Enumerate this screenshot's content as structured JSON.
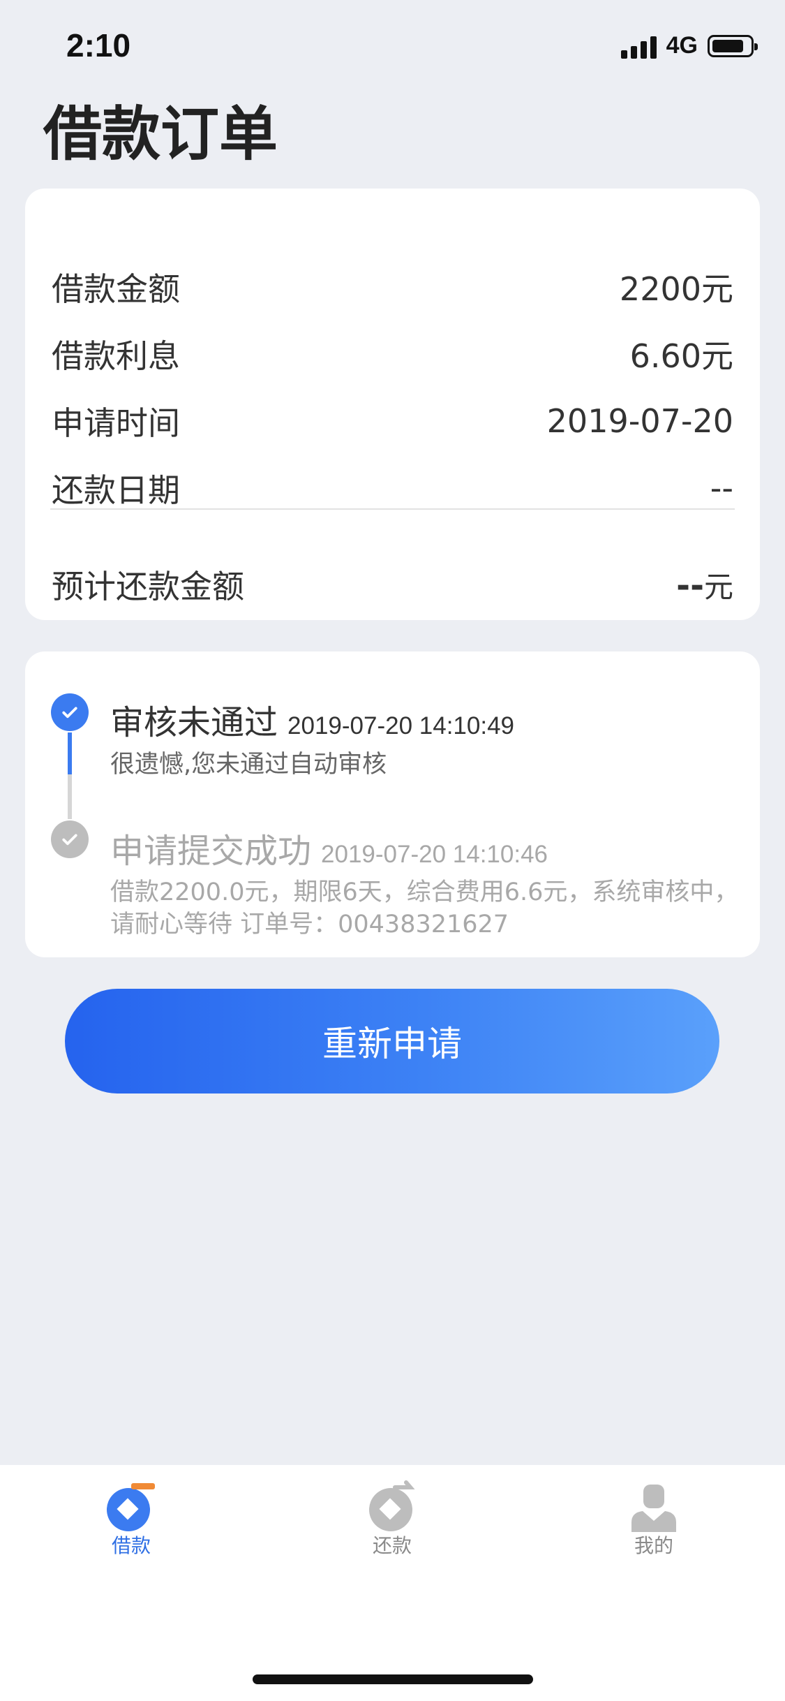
{
  "status_bar": {
    "time": "2:10",
    "network": "4G"
  },
  "page": {
    "title": "借款订单"
  },
  "summary": {
    "rows": [
      {
        "label": "借款金额",
        "value": "2200元"
      },
      {
        "label": "借款利息",
        "value": "6.60元"
      },
      {
        "label": "申请时间",
        "value": "2019-07-20"
      },
      {
        "label": "还款日期",
        "value": "--"
      }
    ],
    "total": {
      "label": "预计还款金额",
      "value": "--",
      "unit": "元"
    }
  },
  "timeline": [
    {
      "title": "审核未通过",
      "time": "2019-07-20 14:10:49",
      "desc": [
        "很遗憾,您未通过自动审核"
      ],
      "state": "current",
      "color": "#3b7bf0"
    },
    {
      "title": "申请提交成功",
      "time": "2019-07-20 14:10:46",
      "desc": [
        "借款2200.0元，期限6天，综合费用6.6元，系统审核中，",
        "请耐心等待 订单号：00438321627"
      ],
      "state": "past",
      "color": "#bdbdbd"
    }
  ],
  "actions": {
    "reapply_label": "重新申请"
  },
  "tabbar": {
    "items": [
      {
        "label": "借款",
        "icon": "loan-icon",
        "active": true
      },
      {
        "label": "还款",
        "icon": "repay-icon",
        "active": false
      },
      {
        "label": "我的",
        "icon": "profile-icon",
        "active": false
      }
    ]
  },
  "colors": {
    "accent": "#2f6fe4",
    "background": "#eceef3",
    "tab_active_badge": "#f08a35"
  }
}
